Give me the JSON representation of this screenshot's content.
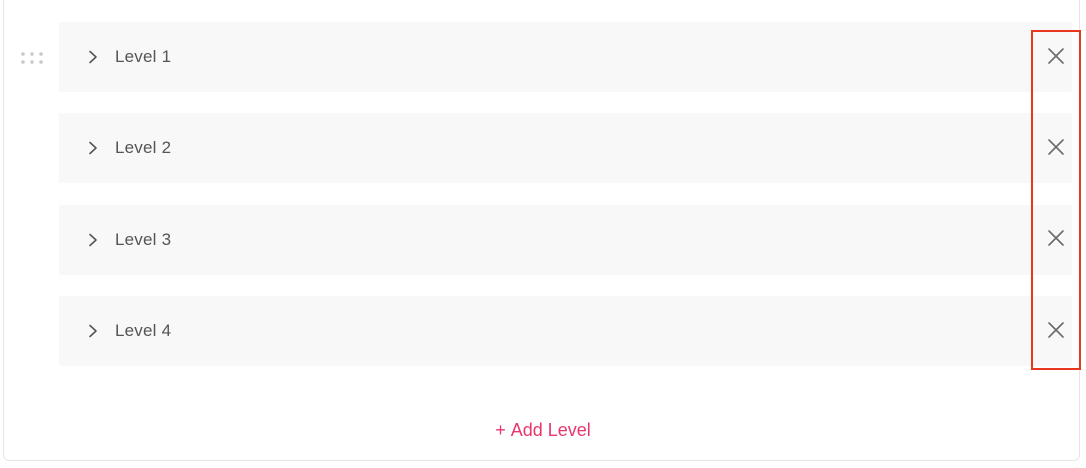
{
  "levels": [
    {
      "label": "Level 1"
    },
    {
      "label": "Level 2"
    },
    {
      "label": "Level 3"
    },
    {
      "label": "Level 4"
    }
  ],
  "add_button": {
    "plus": "+",
    "label": "Add Level"
  },
  "icons": {
    "expand": "chevron-right-icon",
    "remove": "close-icon",
    "drag": "drag-handle-icon"
  },
  "colors": {
    "row_background": "#f8f8f8",
    "accent": "#e8356b",
    "highlight": "#e8371f",
    "text": "#555555"
  }
}
